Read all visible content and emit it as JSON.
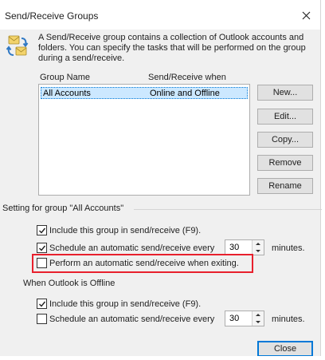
{
  "window": {
    "title": "Send/Receive Groups"
  },
  "intro": {
    "icon": "send-receive-groups-icon",
    "description": "A Send/Receive group contains a collection of Outlook accounts and folders. You can specify the tasks that will be performed on the group during a send/receive."
  },
  "groups_list": {
    "columns": [
      "Group Name",
      "Send/Receive when"
    ],
    "rows": [
      {
        "name": "All Accounts",
        "when": "Online and Offline",
        "selected": true
      }
    ]
  },
  "side_buttons": {
    "new": "New...",
    "edit": "Edit...",
    "copy": "Copy...",
    "remove": "Remove",
    "rename": "Rename"
  },
  "settings": {
    "group_label": "Setting for group \"All Accounts\"",
    "online": {
      "include": {
        "label": "Include this group in send/receive (F9).",
        "checked": true
      },
      "schedule": {
        "label": "Schedule an automatic send/receive every",
        "checked": true,
        "minutes_value": "30",
        "minutes_label": "minutes."
      },
      "on_exit": {
        "label": "Perform an automatic send/receive when exiting.",
        "checked": false
      }
    },
    "offline_label": "When Outlook is Offline",
    "offline": {
      "include": {
        "label": "Include this group in send/receive (F9).",
        "checked": true
      },
      "schedule": {
        "label": "Schedule an automatic send/receive every",
        "checked": false,
        "minutes_value": "30",
        "minutes_label": "minutes."
      }
    }
  },
  "footer": {
    "close": "Close"
  },
  "colors": {
    "highlight_border": "#e8202d",
    "selection": "#cce8ff",
    "accent": "#0078d7"
  }
}
